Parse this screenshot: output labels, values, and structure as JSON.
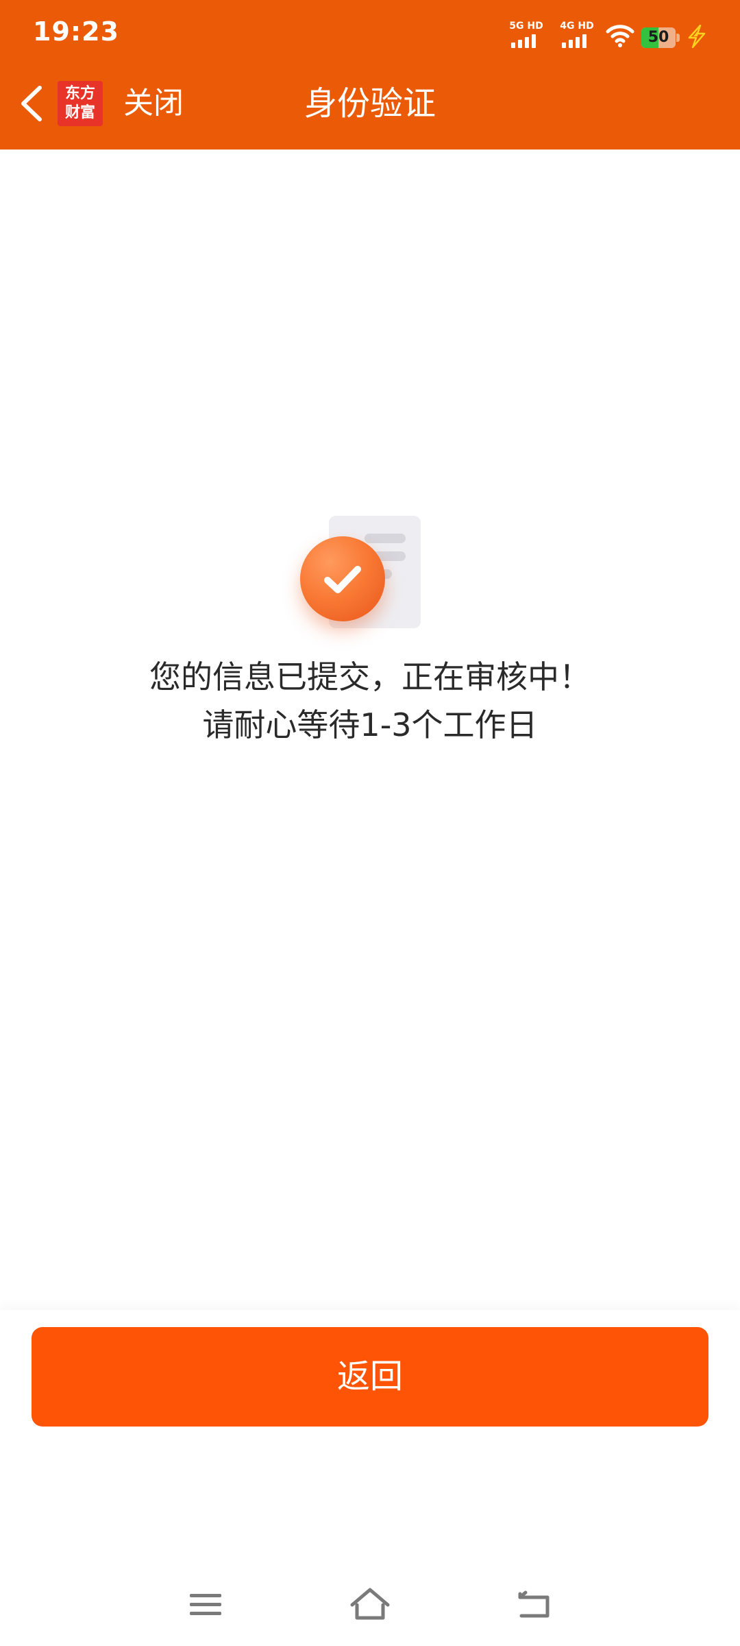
{
  "status_bar": {
    "time": "19:23",
    "signal_1_label": "5G HD",
    "signal_2_label": "4G HD",
    "battery_level": 50,
    "battery_text": "50",
    "icons": [
      "signal-icon",
      "signal-icon",
      "wifi-icon",
      "battery-icon",
      "charging-icon"
    ]
  },
  "nav": {
    "back_icon": "chevron-left-icon",
    "brand_line1": "东方",
    "brand_line2": "财富",
    "close_label": "关闭",
    "title": "身份验证"
  },
  "content": {
    "icon": "check-document-icon",
    "message_line1": "您的信息已提交，正在审核中！",
    "message_line2": "请耐心等待1-3个工作日"
  },
  "actions": {
    "return_label": "返回"
  },
  "system_nav": {
    "icons": [
      "menu-icon",
      "home-icon",
      "back-icon"
    ]
  },
  "colors": {
    "header": "#eb5a06",
    "button": "#fd5505",
    "text": "#2a2a2a",
    "background": "#ffffff"
  }
}
